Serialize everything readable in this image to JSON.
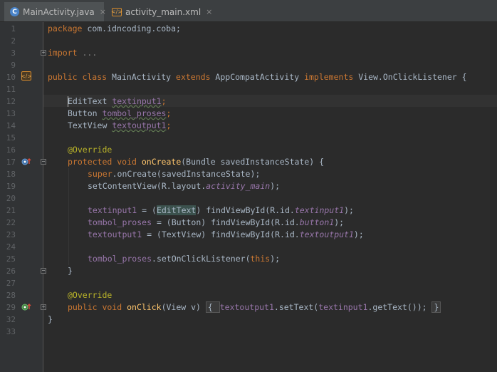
{
  "tabs": [
    {
      "label": "MainActivity.java",
      "icon": "java-class-icon",
      "active": true
    },
    {
      "label": "activity_main.xml",
      "icon": "xml-layout-icon",
      "active": false
    }
  ],
  "tab_close_glyph": "×",
  "tab_icon_c": "C",
  "tab_icon_x": "</>",
  "line_numbers": [
    "1",
    "2",
    "3",
    "9",
    "10",
    "11",
    "12",
    "13",
    "14",
    "15",
    "16",
    "17",
    "18",
    "19",
    "20",
    "21",
    "22",
    "23",
    "24",
    "25",
    "26",
    "27",
    "28",
    "29",
    "32",
    "33"
  ],
  "code": {
    "l1_kw": "package",
    "l1_rest": " com.idncoding.coba;",
    "l3_kw": "import",
    "l3_rest": " ...",
    "l10_a": "public class",
    "l10_b": " MainActivity ",
    "l10_c": "extends",
    "l10_d": " AppCompatActivity ",
    "l10_e": "implements",
    "l10_f": " View.OnClickListener {",
    "l12_a": "EditText",
    "l12_b": "textinput1",
    "l12_c": ";",
    "l13_a": "Button ",
    "l13_b": "tombol_proses",
    "l13_c": ";",
    "l14_a": "TextView ",
    "l14_b": "textoutput1",
    "l14_c": ";",
    "l16": "@Override",
    "l17_a": "protected void ",
    "l17_b": "onCreate",
    "l17_c": "(Bundle savedInstanceState) {",
    "l18_a": "super",
    "l18_b": ".onCreate(savedInstanceState);",
    "l19_a": "setContentView(R.layout.",
    "l19_b": "activity_main",
    "l19_c": ");",
    "l21_a": "textinput1",
    "l21_b": " = (",
    "l21_c": "EditText",
    "l21_d": ") findViewById(R.id.",
    "l21_e": "textinput1",
    "l21_f": ");",
    "l22_a": "tombol_proses",
    "l22_b": " = (Button) findViewById(R.id.",
    "l22_c": "button1",
    "l22_d": ");",
    "l23_a": "textoutput1",
    "l23_b": " = (TextView) findViewById(R.id.",
    "l23_c": "textoutput1",
    "l23_d": ");",
    "l25_a": "tombol_proses",
    "l25_b": ".setOnClickListener(",
    "l25_c": "this",
    "l25_d": ");",
    "l26": "}",
    "l28": "@Override",
    "l29_a": "public void ",
    "l29_b": "onClick",
    "l29_c": "(View v) ",
    "l29_d": "{ ",
    "l29_e": "textoutput1",
    "l29_f": ".setText(",
    "l29_g": "textinput1",
    "l29_h": ".getText()); ",
    "l29_i": "}",
    "l32": "}"
  },
  "colors": {
    "background": "#2b2b2b",
    "keyword": "#cc7832",
    "annotation": "#bbb529",
    "field": "#9876aa",
    "method": "#ffc66d",
    "text": "#a9b7c6"
  }
}
